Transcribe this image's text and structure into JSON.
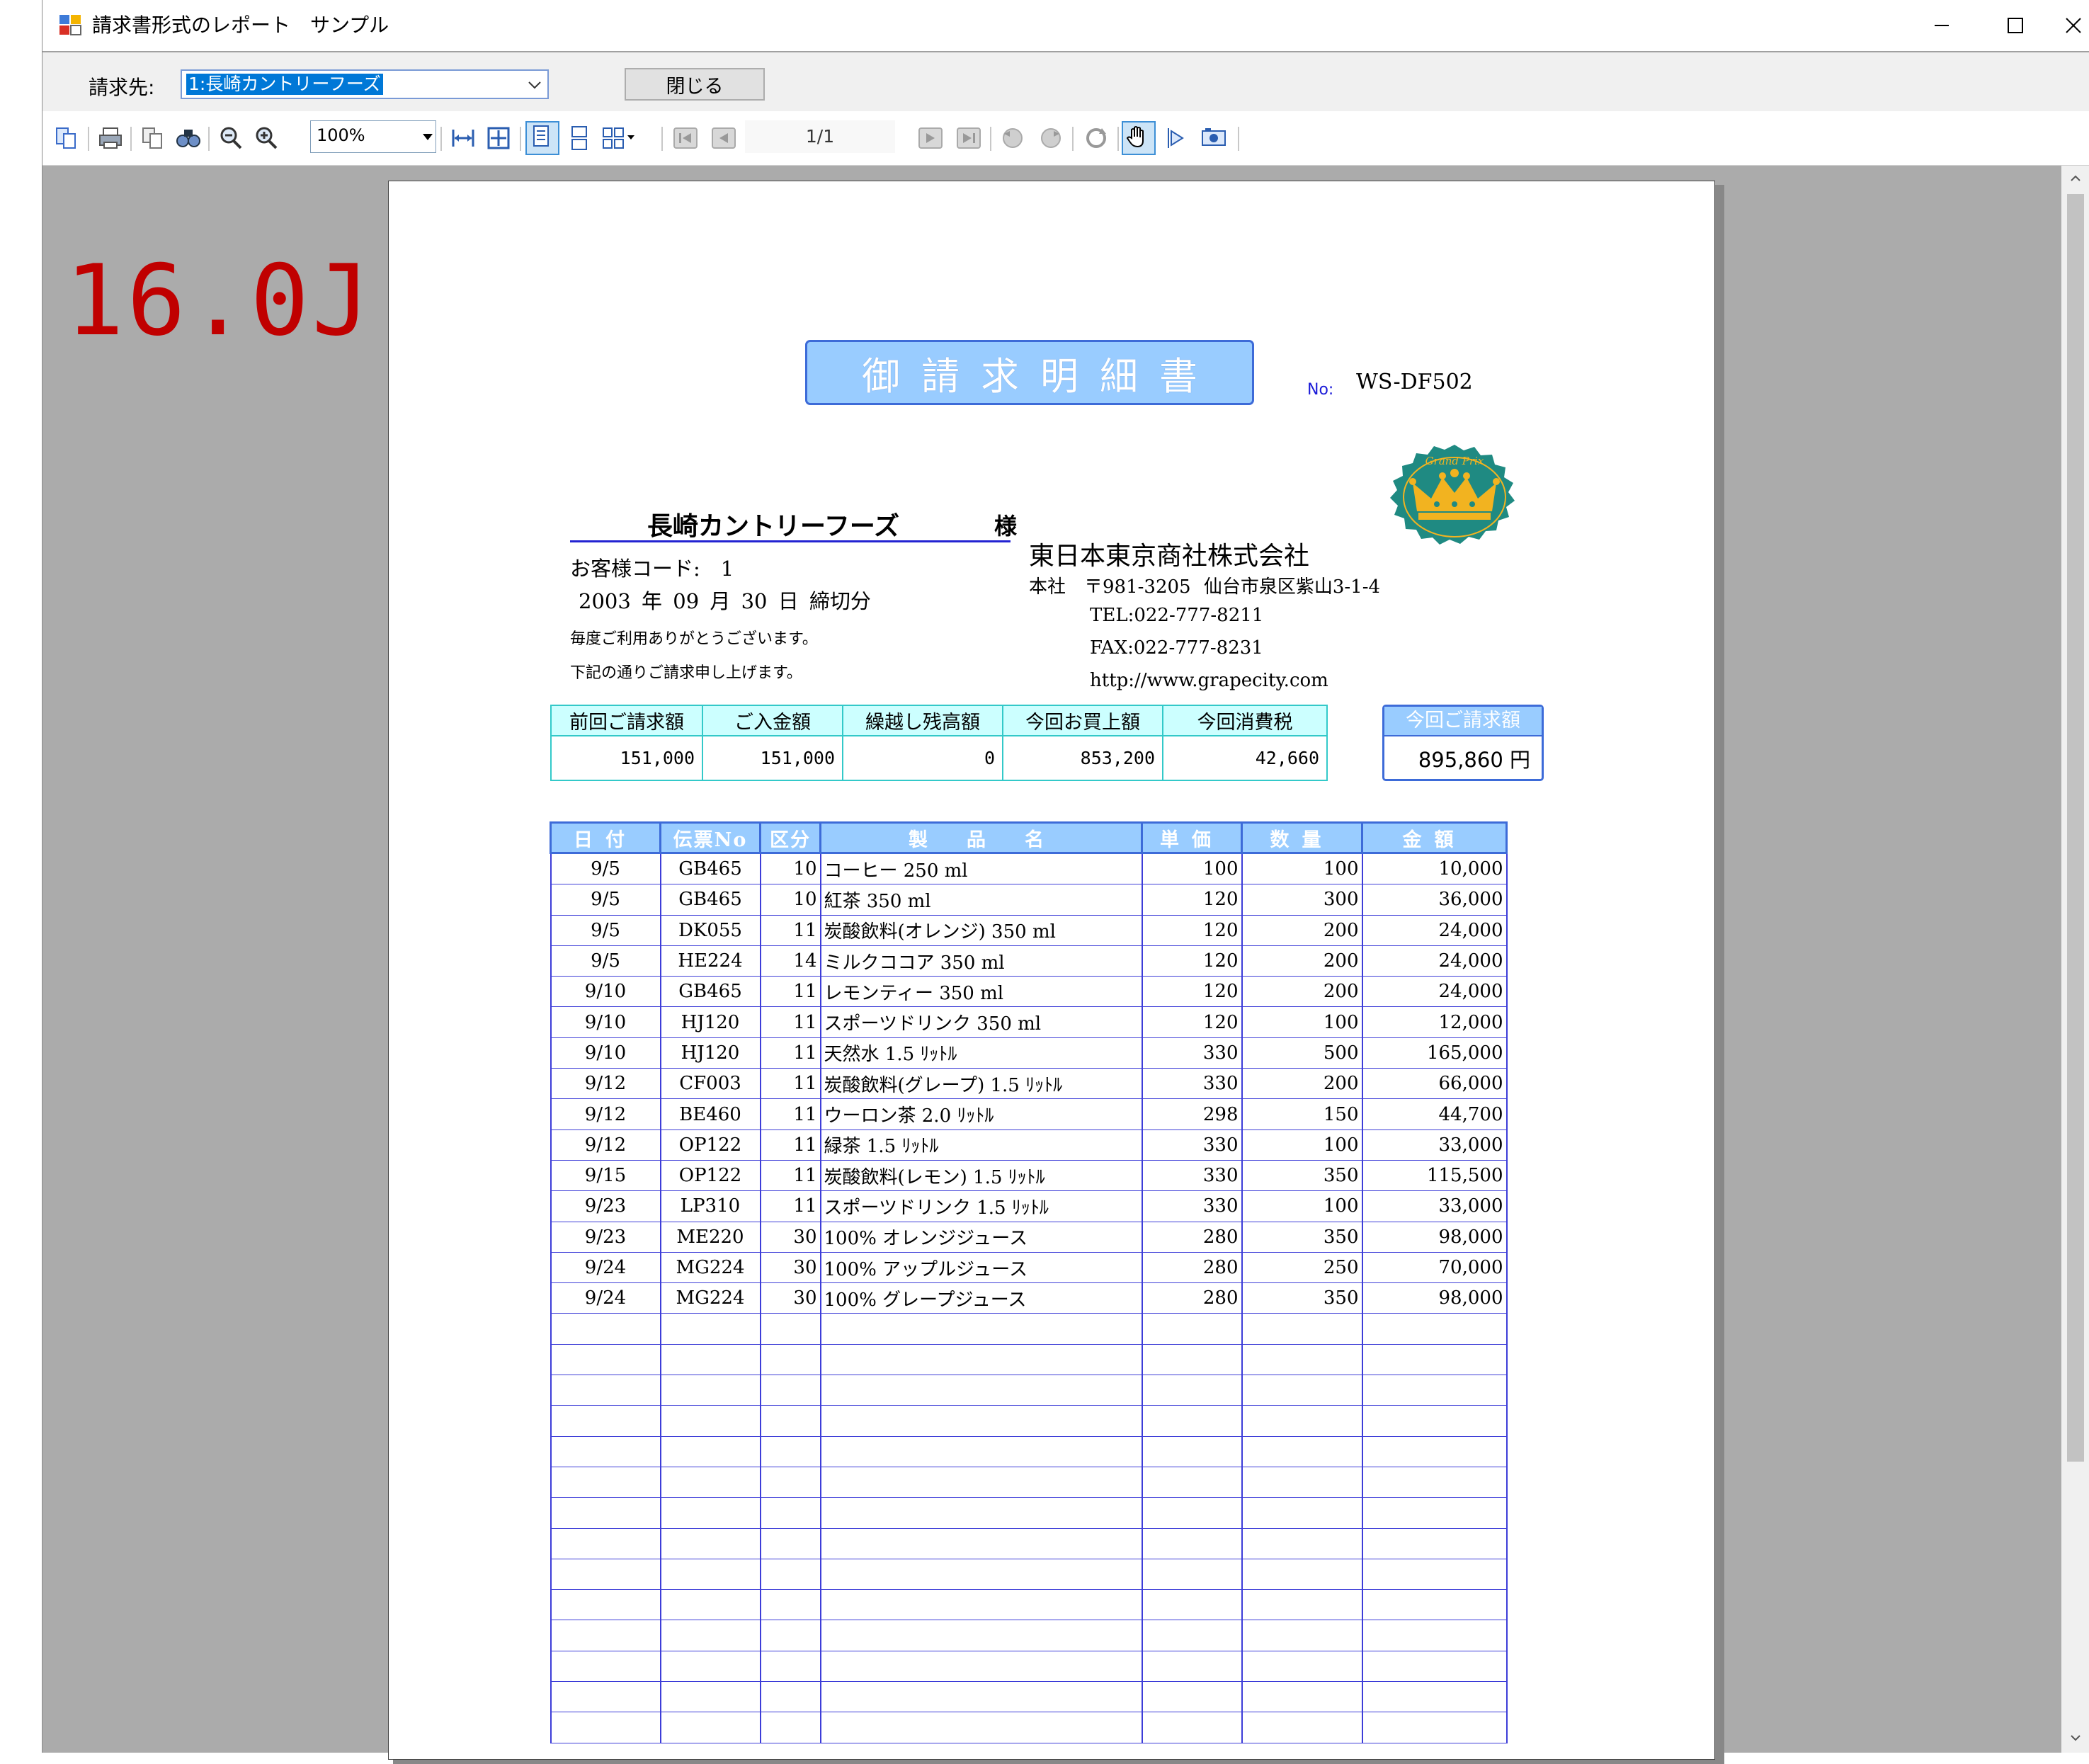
{
  "overlay": {
    "version": "16.0J"
  },
  "window": {
    "title": "請求書形式のレポート　サンプル",
    "minimize_icon": "minimize-icon",
    "maximize_icon": "maximize-icon",
    "close_icon": "close-icon"
  },
  "form": {
    "customer_label": "請求先:",
    "customer_selected": "1:長崎カントリーフーズ",
    "close_button": "閉じる"
  },
  "toolbar": {
    "zoom": "100%",
    "page_indicator": "1/1",
    "icons": [
      "toc-icon",
      "print-icon",
      "copy-icon",
      "find-icon",
      "zoom-out-icon",
      "zoom-in-icon",
      "fit-width-icon",
      "fit-page-icon",
      "single-page-icon",
      "continuous-icon",
      "multipage-icon",
      "first-page-icon",
      "prev-page-icon",
      "next-page-icon",
      "last-page-icon",
      "back-icon",
      "forward-icon",
      "refresh-icon",
      "pan-icon",
      "select-icon",
      "snapshot-icon"
    ]
  },
  "report": {
    "title": "御請求明細書",
    "no_label": "No:",
    "no_value": "WS-DF502",
    "customer_name": "長崎カントリーフーズ",
    "customer_honorific": "様",
    "customer_code": "お客様コード:　1",
    "closing_date": "2003 年 09 月 30 日 締切分",
    "message_1": "毎度ご利用ありがとうございます。",
    "message_2": "下記の通りご請求申し上げます。",
    "company": "東日本東京商社株式会社",
    "address": "本社　〒981-3205 仙台市泉区紫山3-1-4",
    "tel": "TEL:022-777-8211",
    "fax": "FAX:022-777-8231",
    "url": "http://www.grapecity.com",
    "seal_text": "Grand Prix",
    "summary": {
      "headers": [
        "前回ご請求額",
        "ご入金額",
        "繰越し残高額",
        "今回お買上額",
        "今回消費税"
      ],
      "values": [
        "151,000",
        "151,000",
        "0",
        "853,200",
        "42,660"
      ],
      "total_header": "今回ご請求額",
      "total_value": "895,860 円"
    },
    "detail_headers": [
      "日付",
      "伝票No",
      "区分",
      "製　品　名",
      "単価",
      "数量",
      "金額"
    ],
    "rows": [
      [
        "9/5",
        "GB465",
        "10",
        "コーヒー 250 ml",
        "100",
        "100",
        "10,000"
      ],
      [
        "9/5",
        "GB465",
        "10",
        "紅茶 350 ml",
        "120",
        "300",
        "36,000"
      ],
      [
        "9/5",
        "DK055",
        "11",
        "炭酸飲料(オレンジ) 350 ml",
        "120",
        "200",
        "24,000"
      ],
      [
        "9/5",
        "HE224",
        "14",
        "ミルクココア 350 ml",
        "120",
        "200",
        "24,000"
      ],
      [
        "9/10",
        "GB465",
        "11",
        "レモンティー 350 ml",
        "120",
        "200",
        "24,000"
      ],
      [
        "9/10",
        "HJ120",
        "11",
        "スポーツドリンク 350 ml",
        "120",
        "100",
        "12,000"
      ],
      [
        "9/10",
        "HJ120",
        "11",
        "天然水 1.5 ﾘｯﾄﾙ",
        "330",
        "500",
        "165,000"
      ],
      [
        "9/12",
        "CF003",
        "11",
        "炭酸飲料(グレープ) 1.5 ﾘｯﾄﾙ",
        "330",
        "200",
        "66,000"
      ],
      [
        "9/12",
        "BE460",
        "11",
        "ウーロン茶 2.0 ﾘｯﾄﾙ",
        "298",
        "150",
        "44,700"
      ],
      [
        "9/12",
        "OP122",
        "11",
        "緑茶 1.5 ﾘｯﾄﾙ",
        "330",
        "100",
        "33,000"
      ],
      [
        "9/15",
        "OP122",
        "11",
        "炭酸飲料(レモン) 1.5 ﾘｯﾄﾙ",
        "330",
        "350",
        "115,500"
      ],
      [
        "9/23",
        "LP310",
        "11",
        "スポーツドリンク 1.5 ﾘｯﾄﾙ",
        "330",
        "100",
        "33,000"
      ],
      [
        "9/23",
        "ME220",
        "30",
        "100% オレンジジュース",
        "280",
        "350",
        "98,000"
      ],
      [
        "9/24",
        "MG224",
        "30",
        "100% アップルジュース",
        "280",
        "250",
        "70,000"
      ],
      [
        "9/24",
        "MG224",
        "30",
        "100% グレープジュース",
        "280",
        "350",
        "98,000"
      ]
    ],
    "empty_rows": 14
  },
  "colors": {
    "title_fill": "#99ccff",
    "title_border": "#3d6bd8",
    "summary_fill": "#ccffff",
    "summary_border": "#33c9c9",
    "seal_fill": "#1f8a82",
    "seal_crown": "#f2b320",
    "version_red": "#c00000"
  }
}
